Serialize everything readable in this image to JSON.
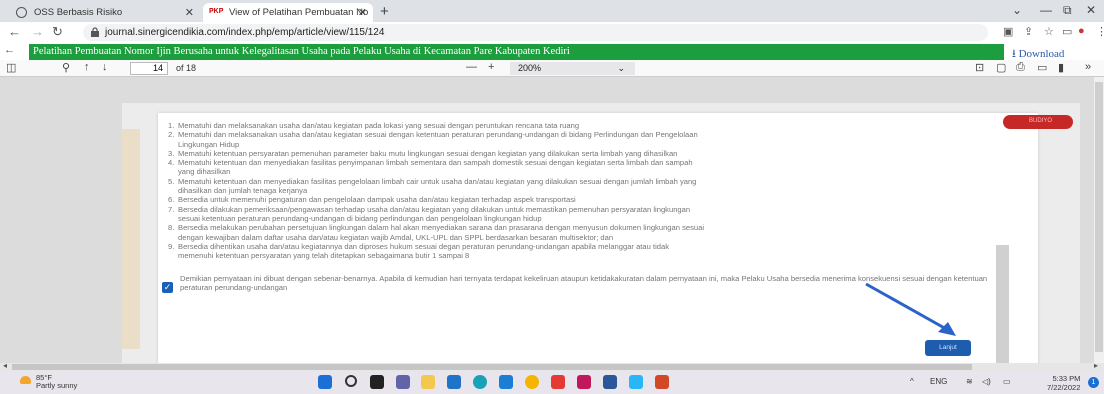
{
  "browser": {
    "tabs": [
      {
        "title": "OSS Berbasis Risiko"
      },
      {
        "title": "View of Pelatihan Pembuatan No"
      }
    ],
    "url": "journal.sinergicendikia.com/index.php/emp/article/view/115/124"
  },
  "pdf_header": {
    "title": "Pelatihan Pembuatan Nomor Ijin Berusaha untuk Kelegalitasan Usaha pada Pelaku Usaha di Kecamatan Pare Kabupaten Kediri",
    "download_label": "Download"
  },
  "pdf_toolbar": {
    "page_current": "14",
    "page_count": "of 18",
    "zoom": "200%"
  },
  "modal": {
    "red_pill_text": "BUDIYO",
    "items": [
      {
        "num": "1.",
        "text": "Mematuhi dan melaksanakan usaha dan/atau kegiatan pada lokasi yang sesuai dengan peruntukan rencana tata ruang"
      },
      {
        "num": "2.",
        "text": "Mematuhi dan melaksanakan usaha dan/atau kegiatan sesuai dengan ketentuan peraturan perundang-undangan di bidang Perlindungan dan Pengelolaan",
        "cont": "Lingkungan Hidup"
      },
      {
        "num": "3.",
        "text": "Mematuhi ketentuan persyaratan pemenuhan parameter baku mutu lingkungan sesuai dengan kegiatan yang dilakukan serta limbah yang dihasilkan"
      },
      {
        "num": "4.",
        "text": "Mematuhi ketentuan dan menyediakan fasilitas penyimpanan limbah sementara dan sampah domestik sesuai dengan kegiatan serta limbah dan sampah",
        "cont": "yang dihasilkan"
      },
      {
        "num": "5.",
        "text": "Mematuhi ketentuan dan menyediakan fasilitas pengelolaan limbah cair untuk usaha dan/atau kegiatan yang dilakukan sesuai dengan jumlah limbah yang",
        "cont": "dihasilkan dan jumlah tenaga kerjanya"
      },
      {
        "num": "6.",
        "text": "Bersedia untuk memenuhi pengaturan dan pengelolaan dampak usaha dan/atau kegiatan terhadap aspek transportasi"
      },
      {
        "num": "7.",
        "text": "Bersedia dilakukan pemeriksaan/pengawasan terhadap usaha dan/atau kegiatan yang dilakukan untuk memastikan pemenuhan persyaratan lingkungan",
        "cont": "sesuai ketentuan peraturan perundang-undangan di bidang perlindungan dan pengelolaan lingkungan hidup"
      },
      {
        "num": "8.",
        "text": "Bersedia melakukan perubahan persetujuan lingkungan dalam hal akan menyediakan sarana dan prasarana dengan menyusun dokumen lingkungan sesuai",
        "cont": "dengan kewajiban dalam daftar usaha dan/atau kegiatan wajib Amdal, UKL-UPL dan SPPL berdasarkan besaran multisektor; dan"
      },
      {
        "num": "9.",
        "text": "Bersedia dihentikan usaha dan/atau kegiatannya dan diproses hukum sesuai degan peraturan perundang-undangan apabila melanggar atau tidak",
        "cont": "memenuhi ketentuan persyaratan yang telah ditetapkan sebagaimana butir 1 sampai 8"
      }
    ],
    "declaration": "Demikian pernyataan ini dibuat dengan sebenar-benarnya. Apabila di kemudian hari ternyata terdapat kekeliruan ataupun ketidakakuratan dalam pernyataan ini, maka Pelaku Usaha bersedia menerima konsekuensi sesuai dengan ketentuan peraturan perundang-undangan",
    "button_label": "Lanjut"
  },
  "taskbar": {
    "weather_temp": "85°F",
    "weather_desc": "Partly sunny",
    "lang": "ENG",
    "time": "5:33 PM",
    "date": "7/22/2022",
    "notif_count": "1"
  },
  "colors": {
    "green_bar": "#1c9d3e",
    "primary_button": "#1e5cae",
    "red_pill": "#c62828"
  }
}
